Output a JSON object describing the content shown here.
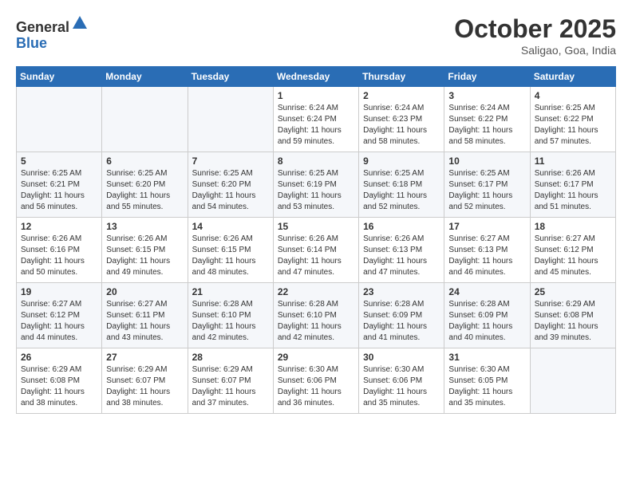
{
  "header": {
    "logo_general": "General",
    "logo_blue": "Blue",
    "month": "October 2025",
    "location": "Saligao, Goa, India"
  },
  "days_of_week": [
    "Sunday",
    "Monday",
    "Tuesday",
    "Wednesday",
    "Thursday",
    "Friday",
    "Saturday"
  ],
  "weeks": [
    [
      {
        "day": "",
        "info": ""
      },
      {
        "day": "",
        "info": ""
      },
      {
        "day": "",
        "info": ""
      },
      {
        "day": "1",
        "info": "Sunrise: 6:24 AM\nSunset: 6:24 PM\nDaylight: 11 hours\nand 59 minutes."
      },
      {
        "day": "2",
        "info": "Sunrise: 6:24 AM\nSunset: 6:23 PM\nDaylight: 11 hours\nand 58 minutes."
      },
      {
        "day": "3",
        "info": "Sunrise: 6:24 AM\nSunset: 6:22 PM\nDaylight: 11 hours\nand 58 minutes."
      },
      {
        "day": "4",
        "info": "Sunrise: 6:25 AM\nSunset: 6:22 PM\nDaylight: 11 hours\nand 57 minutes."
      }
    ],
    [
      {
        "day": "5",
        "info": "Sunrise: 6:25 AM\nSunset: 6:21 PM\nDaylight: 11 hours\nand 56 minutes."
      },
      {
        "day": "6",
        "info": "Sunrise: 6:25 AM\nSunset: 6:20 PM\nDaylight: 11 hours\nand 55 minutes."
      },
      {
        "day": "7",
        "info": "Sunrise: 6:25 AM\nSunset: 6:20 PM\nDaylight: 11 hours\nand 54 minutes."
      },
      {
        "day": "8",
        "info": "Sunrise: 6:25 AM\nSunset: 6:19 PM\nDaylight: 11 hours\nand 53 minutes."
      },
      {
        "day": "9",
        "info": "Sunrise: 6:25 AM\nSunset: 6:18 PM\nDaylight: 11 hours\nand 52 minutes."
      },
      {
        "day": "10",
        "info": "Sunrise: 6:25 AM\nSunset: 6:17 PM\nDaylight: 11 hours\nand 52 minutes."
      },
      {
        "day": "11",
        "info": "Sunrise: 6:26 AM\nSunset: 6:17 PM\nDaylight: 11 hours\nand 51 minutes."
      }
    ],
    [
      {
        "day": "12",
        "info": "Sunrise: 6:26 AM\nSunset: 6:16 PM\nDaylight: 11 hours\nand 50 minutes."
      },
      {
        "day": "13",
        "info": "Sunrise: 6:26 AM\nSunset: 6:15 PM\nDaylight: 11 hours\nand 49 minutes."
      },
      {
        "day": "14",
        "info": "Sunrise: 6:26 AM\nSunset: 6:15 PM\nDaylight: 11 hours\nand 48 minutes."
      },
      {
        "day": "15",
        "info": "Sunrise: 6:26 AM\nSunset: 6:14 PM\nDaylight: 11 hours\nand 47 minutes."
      },
      {
        "day": "16",
        "info": "Sunrise: 6:26 AM\nSunset: 6:13 PM\nDaylight: 11 hours\nand 47 minutes."
      },
      {
        "day": "17",
        "info": "Sunrise: 6:27 AM\nSunset: 6:13 PM\nDaylight: 11 hours\nand 46 minutes."
      },
      {
        "day": "18",
        "info": "Sunrise: 6:27 AM\nSunset: 6:12 PM\nDaylight: 11 hours\nand 45 minutes."
      }
    ],
    [
      {
        "day": "19",
        "info": "Sunrise: 6:27 AM\nSunset: 6:12 PM\nDaylight: 11 hours\nand 44 minutes."
      },
      {
        "day": "20",
        "info": "Sunrise: 6:27 AM\nSunset: 6:11 PM\nDaylight: 11 hours\nand 43 minutes."
      },
      {
        "day": "21",
        "info": "Sunrise: 6:28 AM\nSunset: 6:10 PM\nDaylight: 11 hours\nand 42 minutes."
      },
      {
        "day": "22",
        "info": "Sunrise: 6:28 AM\nSunset: 6:10 PM\nDaylight: 11 hours\nand 42 minutes."
      },
      {
        "day": "23",
        "info": "Sunrise: 6:28 AM\nSunset: 6:09 PM\nDaylight: 11 hours\nand 41 minutes."
      },
      {
        "day": "24",
        "info": "Sunrise: 6:28 AM\nSunset: 6:09 PM\nDaylight: 11 hours\nand 40 minutes."
      },
      {
        "day": "25",
        "info": "Sunrise: 6:29 AM\nSunset: 6:08 PM\nDaylight: 11 hours\nand 39 minutes."
      }
    ],
    [
      {
        "day": "26",
        "info": "Sunrise: 6:29 AM\nSunset: 6:08 PM\nDaylight: 11 hours\nand 38 minutes."
      },
      {
        "day": "27",
        "info": "Sunrise: 6:29 AM\nSunset: 6:07 PM\nDaylight: 11 hours\nand 38 minutes."
      },
      {
        "day": "28",
        "info": "Sunrise: 6:29 AM\nSunset: 6:07 PM\nDaylight: 11 hours\nand 37 minutes."
      },
      {
        "day": "29",
        "info": "Sunrise: 6:30 AM\nSunset: 6:06 PM\nDaylight: 11 hours\nand 36 minutes."
      },
      {
        "day": "30",
        "info": "Sunrise: 6:30 AM\nSunset: 6:06 PM\nDaylight: 11 hours\nand 35 minutes."
      },
      {
        "day": "31",
        "info": "Sunrise: 6:30 AM\nSunset: 6:05 PM\nDaylight: 11 hours\nand 35 minutes."
      },
      {
        "day": "",
        "info": ""
      }
    ]
  ]
}
